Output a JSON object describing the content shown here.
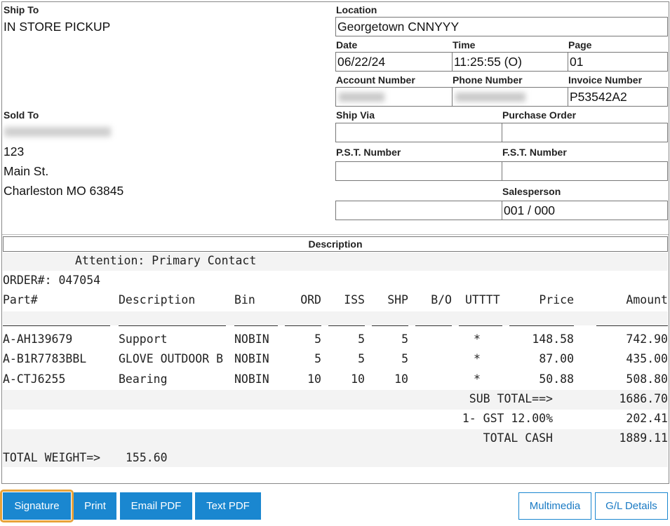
{
  "ship_to": {
    "label": "Ship To",
    "value": "IN STORE PICKUP"
  },
  "location": {
    "label": "Location",
    "value": "Georgetown CNNYYY"
  },
  "date": {
    "label": "Date",
    "value": "06/22/24"
  },
  "time": {
    "label": "Time",
    "value": "11:25:55 (O)"
  },
  "page": {
    "label": "Page",
    "value": "01"
  },
  "account_number": {
    "label": "Account Number",
    "value": ""
  },
  "phone_number": {
    "label": "Phone Number",
    "value": ""
  },
  "invoice_number": {
    "label": "Invoice Number",
    "value": "P53542A2"
  },
  "sold_to": {
    "label": "Sold To",
    "name": "",
    "line1": "123",
    "line2": "Main St.",
    "line3": "Charleston MO 63845"
  },
  "ship_via": {
    "label": "Ship Via",
    "value": ""
  },
  "purchase_order": {
    "label": "Purchase Order",
    "value": ""
  },
  "pst_number": {
    "label": "P.S.T. Number",
    "value": ""
  },
  "fst_number": {
    "label": "F.S.T. Number",
    "value": ""
  },
  "salesperson": {
    "label": "Salesperson",
    "value": "001 / 000"
  },
  "description_header": "Description",
  "body": {
    "attention": "Attention: Primary Contact",
    "order": "ORDER#: 047054",
    "headers": {
      "part": "Part#",
      "description": "Description",
      "bin": "Bin",
      "ord": "ORD",
      "iss": "ISS",
      "shp": "SHP",
      "bo": "B/O",
      "uttt": "UTTTT",
      "price": "Price",
      "amount": "Amount"
    },
    "rows": [
      {
        "part": "A-AH139679",
        "description": "Support",
        "bin": "NOBIN",
        "ord": "5",
        "iss": "5",
        "shp": "5",
        "bo": "",
        "uttt": "*",
        "price": "148.58",
        "amount": "742.90"
      },
      {
        "part": "A-B1R7783BBL",
        "description": "GLOVE OUTDOOR B",
        "bin": "NOBIN",
        "ord": "5",
        "iss": "5",
        "shp": "5",
        "bo": "",
        "uttt": "*",
        "price": "87.00",
        "amount": "435.00"
      },
      {
        "part": "A-CTJ6255",
        "description": "Bearing",
        "bin": "NOBIN",
        "ord": "10",
        "iss": "10",
        "shp": "10",
        "bo": "",
        "uttt": "*",
        "price": "50.88",
        "amount": "508.80"
      }
    ],
    "subtotal_label": "SUB TOTAL==>",
    "subtotal_value": "1686.70",
    "gst_label": "1- GST 12.00%",
    "gst_value": "202.41",
    "total_label": "TOTAL CASH",
    "total_value": "1889.11",
    "weight_label": "TOTAL WEIGHT=>",
    "weight_value": "155.60"
  },
  "buttons": {
    "signature": "Signature",
    "print": "Print",
    "email_pdf": "Email PDF",
    "text_pdf": "Text PDF",
    "multimedia": "Multimedia",
    "gl_details": "G/L Details"
  },
  "colors": {
    "button_blue": "#1a87d0",
    "focus_ring": "#e8a33a",
    "band_gray": "#f3f3f3"
  }
}
